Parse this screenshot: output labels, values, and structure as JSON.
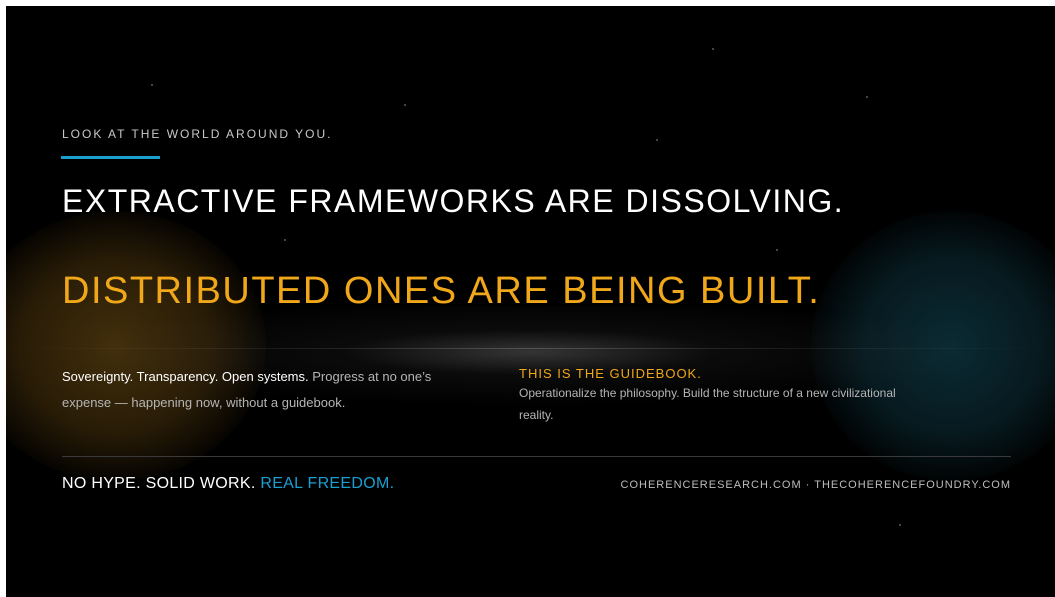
{
  "eyebrow": "LOOK AT THE WORLD AROUND YOU.",
  "headline_primary": "EXTRACTIVE FRAMEWORKS ARE DISSOLVING.",
  "headline_secondary": "DISTRIBUTED ONES ARE BEING BUILT.",
  "body_left": {
    "strong": "Sovereignty. Transparency. Open systems.",
    "rest": "Progress at no one’s expense — happening now, without a guidebook."
  },
  "guidebook": {
    "title": "THIS IS THE GUIDEBOOK.",
    "body": "Operationalize the philosophy. Build the structure of a new civilizational reality."
  },
  "footer": {
    "tagline_plain": "NO HYPE. SOLID WORK.",
    "tagline_accent": "REAL FREEDOM.",
    "urls": "COHERENCERESEARCH.COM · THECOHERENCEFOUNDRY.COM"
  },
  "colors": {
    "background": "#000000",
    "gold": "#f0a71a",
    "cyan": "#1a9fd0",
    "text_primary": "#ffffff",
    "text_muted": "#b5b5b5"
  }
}
